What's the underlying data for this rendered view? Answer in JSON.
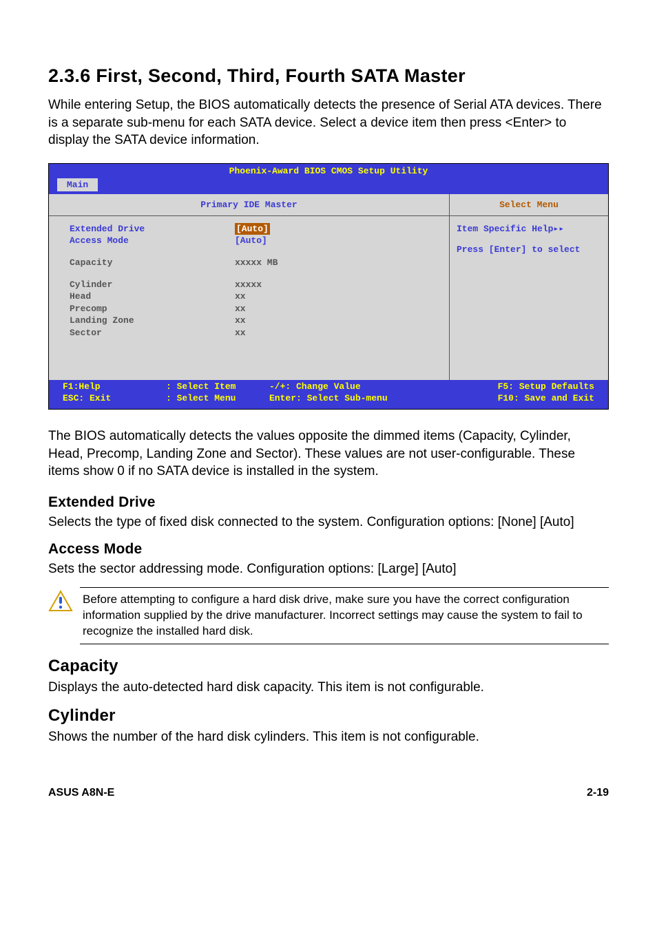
{
  "heading": "2.3.6   First, Second, Third, Fourth SATA Master",
  "intro": "While entering Setup, the BIOS automatically detects the presence of Serial ATA devices. There is a separate sub-menu for each SATA device. Select a device item then press <Enter> to display the SATA device information.",
  "bios": {
    "title": "Phoenix-Award BIOS CMOS Setup Utility",
    "tab": " Main ",
    "left_heading": "Primary IDE Master",
    "rows": {
      "ext_drive_label": "Extended Drive",
      "ext_drive_val": "[Auto]",
      "access_mode_label": "Access Mode",
      "access_mode_val": "[Auto]",
      "capacity_label": "Capacity",
      "capacity_val": "xxxxx MB",
      "cylinder_label": "Cylinder",
      "cylinder_val": "xxxxx",
      "head_label": "Head",
      "head_val": " xx",
      "precomp_label": "Precomp",
      "precomp_val": " xx",
      "landing_label": "Landing Zone",
      "landing_val": " xx",
      "sector_label": "Sector",
      "sector_val": " xx"
    },
    "right_heading": "Select Menu",
    "help_line1": "Item Specific Help▸▸",
    "help_line2": "Press [Enter] to select",
    "footer": {
      "f1": "F1:Help",
      "esc": "ESC: Exit",
      "sel_item": ": Select Item",
      "sel_menu": ": Select Menu",
      "change": "-/+: Change Value",
      "enter": "Enter: Select Sub-menu",
      "f5": "F5: Setup Defaults",
      "f10": "F10: Save and Exit"
    }
  },
  "para2": "The BIOS automatically detects the values opposite the dimmed items (Capacity, Cylinder,  Head, Precomp, Landing Zone and Sector). These values are not user-configurable. These items show 0 if no SATA device is installed in the system.",
  "ext_drive_head": "Extended Drive",
  "ext_drive_text": "Selects the type of fixed disk connected to the system. Configuration options: [None] [Auto]",
  "access_mode_head": "Access Mode",
  "access_mode_text": "Sets the sector addressing mode. Configuration options: [Large] [Auto]",
  "callout": "Before attempting to configure a hard disk drive, make sure you have the correct configuration information supplied by the drive manufacturer. Incorrect settings may cause the system to fail to recognize the installed hard disk.",
  "capacity_head": "Capacity",
  "capacity_text": "Displays the auto-detected hard disk capacity. This item is not configurable.",
  "cylinder_head": "Cylinder",
  "cylinder_text": "Shows the number of the hard disk cylinders. This item is not configurable.",
  "footer_left": "ASUS A8N-E",
  "footer_right": "2-19"
}
